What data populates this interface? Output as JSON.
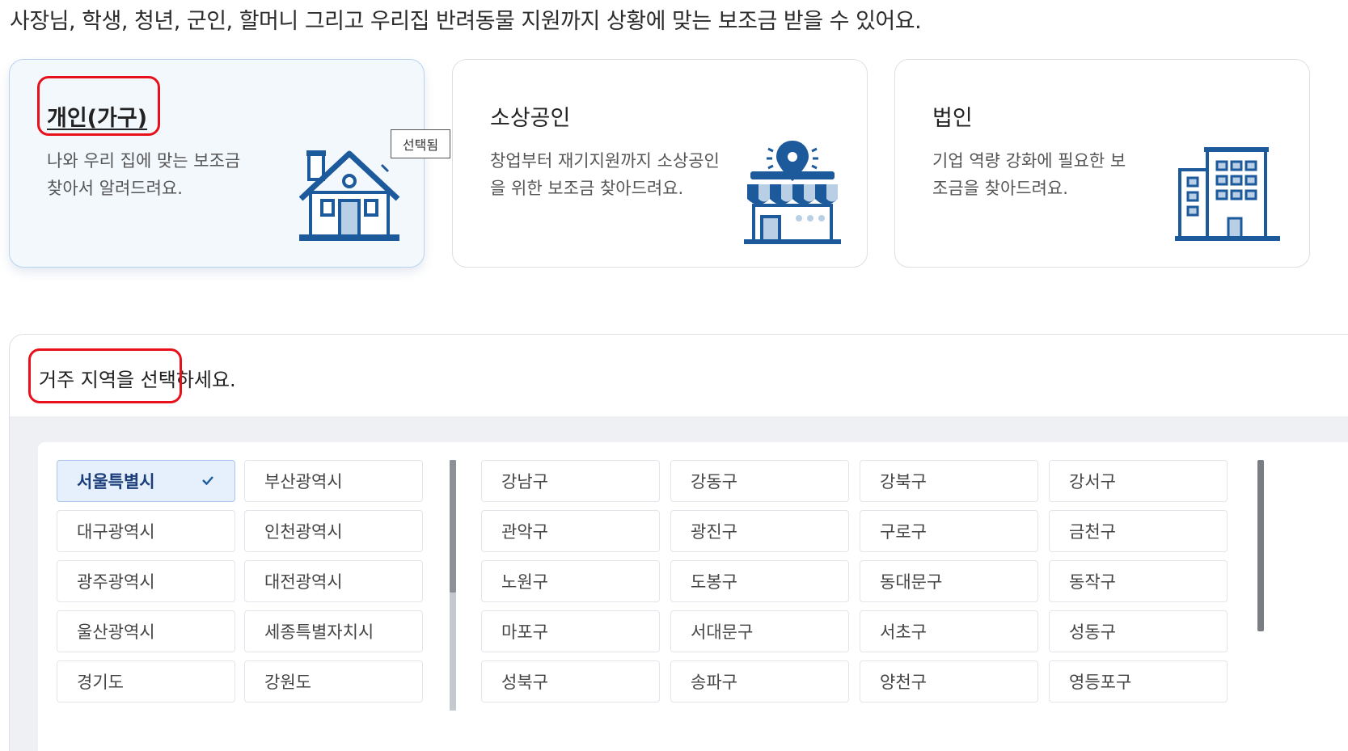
{
  "intro_text": "사장님, 학생, 청년, 군인, 할머니 그리고 우리집 반려동물 지원까지 상황에 맞는 보조금 받을 수 있어요.",
  "cards": [
    {
      "title": "개인(가구)",
      "description": "나와 우리 집에 맞는 보조금 찾아서 알려드려요.",
      "icon": "house-icon",
      "selected": true
    },
    {
      "title": "소상공인",
      "description": "창업부터 재기지원까지 소상공인을 위한 보조금 찾아드려요.",
      "icon": "shop-pin-icon",
      "selected": false
    },
    {
      "title": "법인",
      "description": "기업 역량 강화에 필요한 보조금을 찾아드려요.",
      "icon": "building-icon",
      "selected": false
    }
  ],
  "selected_tag": "선택됨",
  "region_heading": "거주 지역을 선택하세요.",
  "provinces": [
    "서울특별시",
    "부산광역시",
    "대구광역시",
    "인천광역시",
    "광주광역시",
    "대전광역시",
    "울산광역시",
    "세종특별자치시",
    "경기도",
    "강원도"
  ],
  "selected_province": "서울특별시",
  "districts": [
    "강남구",
    "강동구",
    "강북구",
    "강서구",
    "관악구",
    "광진구",
    "구로구",
    "금천구",
    "노원구",
    "도봉구",
    "동대문구",
    "동작구",
    "마포구",
    "서대문구",
    "서초구",
    "성동구",
    "성북구",
    "송파구",
    "양천구",
    "영등포구"
  ],
  "colors": {
    "accent": "#1c5a9c",
    "selected_bg": "#e6f0fc",
    "highlight_red": "#e8101a",
    "panel_gray": "#eef0f3"
  }
}
